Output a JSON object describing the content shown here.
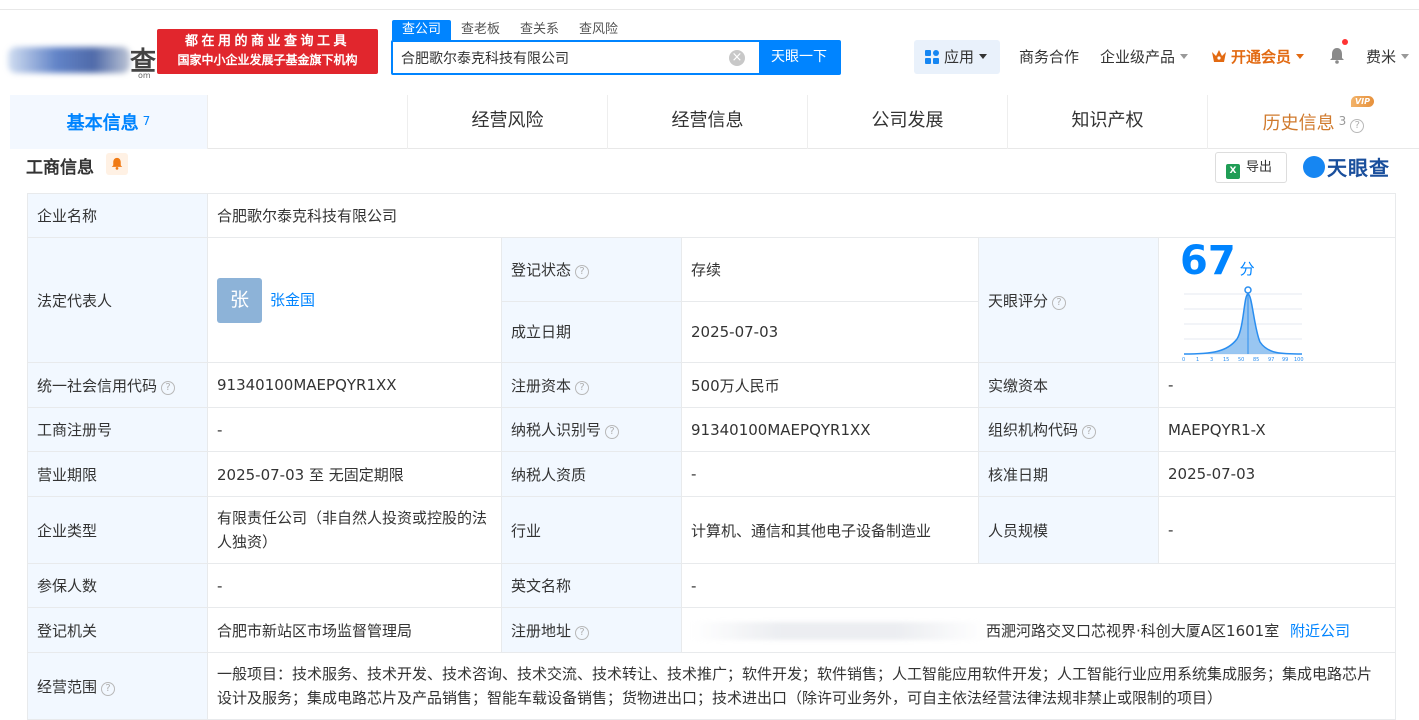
{
  "header": {
    "logo_glyph": "查",
    "logo_suffix": "om",
    "slogan_line1": "都在用的商业查询工具",
    "slogan_line2": "国家中小企业发展子基金旗下机构",
    "search_tabs": [
      "查公司",
      "查老板",
      "查关系",
      "查风险"
    ],
    "search_value": "合肥歌尔泰克科技有限公司",
    "search_button": "天眼一下",
    "nav": {
      "apps": "应用",
      "business": "商务合作",
      "enterprise": "企业级产品",
      "vip": "开通会员",
      "user": "费米"
    }
  },
  "main_tabs": [
    {
      "label": "基本信息",
      "count": "7"
    },
    {
      "label": "经营风险"
    },
    {
      "label": "经营信息"
    },
    {
      "label": "公司发展"
    },
    {
      "label": "知识产权"
    },
    {
      "label": "历史信息",
      "count": "3",
      "badge": "VIP"
    }
  ],
  "section": {
    "title": "工商信息",
    "export": "导出",
    "brand": "天眼查"
  },
  "table": {
    "company_name_label": "企业名称",
    "company_name": "合肥歌尔泰克科技有限公司",
    "legal_rep_label": "法定代表人",
    "legal_rep_avatar": "张",
    "legal_rep": "张金国",
    "reg_status_label": "登记状态",
    "reg_status": "存续",
    "found_date_label": "成立日期",
    "found_date": "2025-07-03",
    "score_label": "天眼评分",
    "score": "67",
    "score_unit": "分",
    "score_axis": [
      "0",
      "1",
      "3",
      "15",
      "50",
      "85",
      "97",
      "99",
      "100"
    ],
    "credit_code_label": "统一社会信用代码",
    "credit_code": "91340100MAEPQYR1XX",
    "reg_capital_label": "注册资本",
    "reg_capital": "500万人民币",
    "paid_capital_label": "实缴资本",
    "paid_capital": "-",
    "biz_reg_no_label": "工商注册号",
    "biz_reg_no": "-",
    "taxpayer_id_label": "纳税人识别号",
    "taxpayer_id": "91340100MAEPQYR1XX",
    "org_code_label": "组织机构代码",
    "org_code": "MAEPQYR1-X",
    "term_label": "营业期限",
    "term": "2025-07-03 至 无固定期限",
    "taxpayer_qual_label": "纳税人资质",
    "taxpayer_qual": "-",
    "approve_date_label": "核准日期",
    "approve_date": "2025-07-03",
    "company_type_label": "企业类型",
    "company_type": "有限责任公司（非自然人投资或控股的法人独资）",
    "industry_label": "行业",
    "industry": "计算机、通信和其他电子设备制造业",
    "staff_label": "人员规模",
    "staff": "-",
    "insured_label": "参保人数",
    "insured": "-",
    "english_name_label": "英文名称",
    "english_name": "-",
    "authority_label": "登记机关",
    "authority": "合肥市新站区市场监督管理局",
    "address_label": "注册地址",
    "address_visible": "西淝河路交叉口芯视界·科创大厦A区1601室",
    "nearby": "附近公司",
    "scope_label": "经营范围",
    "scope": "一般项目：技术服务、技术开发、技术咨询、技术交流、技术转让、技术推广；软件开发；软件销售；人工智能应用软件开发；人工智能行业应用系统集成服务；集成电路芯片设计及服务；集成电路芯片及产品销售；智能车载设备销售；货物进出口；技术进出口（除许可业务外，可自主依法经营法律法规非禁止或限制的项目）"
  },
  "colors": {
    "accent": "#0084ff",
    "slogan_bg": "#e1262d",
    "status_green": "#1ba85e",
    "vip_orange": "#e26a12",
    "label_bg": "#f2f8ff"
  }
}
